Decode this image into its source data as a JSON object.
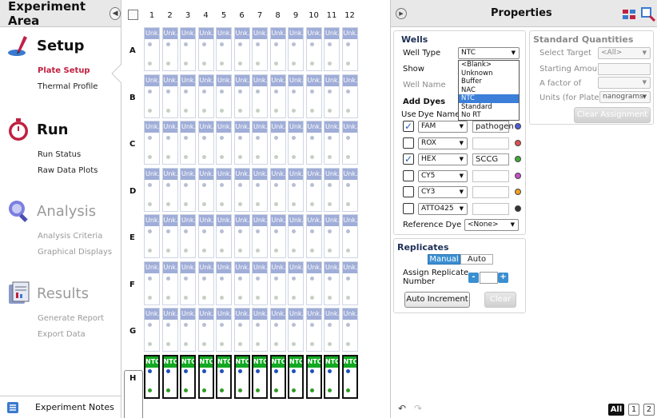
{
  "sidebar": {
    "title": "Experiment Area",
    "collapse_glyph": "◀",
    "sections": [
      {
        "title": "Setup",
        "icon": "setup-pen-icon",
        "items": [
          "Plate Setup",
          "Thermal Profile"
        ]
      },
      {
        "title": "Run",
        "icon": "stopwatch-icon",
        "items": [
          "Run Status",
          "Raw Data Plots"
        ]
      },
      {
        "title": "Analysis",
        "icon": "analysis-magnifier-icon",
        "items": [
          "Analysis Criteria",
          "Graphical Displays"
        ]
      },
      {
        "title": "Results",
        "icon": "results-report-icon",
        "items": [
          "Generate Report",
          "Export Data"
        ]
      }
    ],
    "footer_label": "Experiment Notes"
  },
  "plate": {
    "columns": [
      "1",
      "2",
      "3",
      "4",
      "5",
      "6",
      "7",
      "8",
      "9",
      "10",
      "11",
      "12"
    ],
    "rows": [
      "A",
      "B",
      "C",
      "D",
      "E",
      "F",
      "G",
      "H"
    ],
    "unknown_tag": "Unk...",
    "ntc_tag": "NTC"
  },
  "properties": {
    "title": "Properties",
    "wells": {
      "title": "Wells",
      "well_type_label": "Well Type",
      "well_type_value": "NTC",
      "show_label": "Show",
      "well_name_label": "Well Name",
      "add_dyes_label": "Add Dyes",
      "use_label": "Use",
      "dye_name_label": "Dye Name",
      "dyes": [
        {
          "name": "FAM",
          "checked": true,
          "target": "pathogen",
          "color": "#4f5cd8"
        },
        {
          "name": "ROX",
          "checked": false,
          "target": "",
          "color": "#e05050"
        },
        {
          "name": "HEX",
          "checked": true,
          "target": "SCCG",
          "color": "#3faa3a"
        },
        {
          "name": "CY5",
          "checked": false,
          "target": "",
          "color": "#c050c8"
        },
        {
          "name": "CY3",
          "checked": false,
          "target": "",
          "color": "#f0a020"
        },
        {
          "name": "ATTO425",
          "checked": false,
          "target": "",
          "color": "#333333"
        }
      ],
      "check_glyph": "✓",
      "reference_dye_label": "Reference Dye",
      "reference_dye_value": "<None>"
    },
    "well_type_options": [
      "<Blank>",
      "Unknown",
      "Buffer",
      "NAC",
      "NTC",
      "Standard",
      "No RT"
    ],
    "well_type_selected": "NTC",
    "standard": {
      "title": "Standard Quantities",
      "select_target_label": "Select Target",
      "select_target_value": "<All>",
      "starting_amount_label": "Starting Amount",
      "factor_label": "A factor of",
      "units_label": "Units (for Plate)",
      "units_value": "nanograms",
      "clear_assignment": "Clear Assignment"
    },
    "replicates": {
      "title": "Replicates",
      "mode_manual": "Manual",
      "mode_auto": "Auto",
      "assign_label_1": "Assign Replicate",
      "assign_label_2": "Number",
      "minus": "-",
      "plus": "+",
      "auto_increment": "Auto Increment",
      "clear": "Clear"
    },
    "footer": {
      "undo": "↶",
      "redo": "↷",
      "all": "All",
      "page1": "1",
      "page2": "2"
    }
  },
  "colors": {
    "accent": "#c02040",
    "unknown_tag": "#9fadd8",
    "ntc_tag": "#12a821",
    "selected_blue": "#3a8fd1"
  }
}
